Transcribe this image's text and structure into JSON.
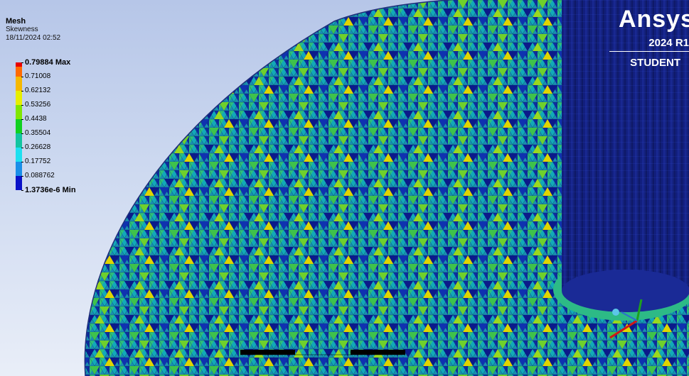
{
  "legend": {
    "title": "Mesh",
    "variable": "Skewness",
    "timestamp": "18/11/2024 02:52",
    "entries": [
      {
        "label": "0.79884 Max",
        "color": "#e80000"
      },
      {
        "label": "0.71008",
        "color": "#ff6a00"
      },
      {
        "label": "0.62132",
        "color": "#f5b800"
      },
      {
        "label": "0.53256",
        "color": "#e7ee00"
      },
      {
        "label": "0.4438",
        "color": "#80e600"
      },
      {
        "label": "0.35504",
        "color": "#10d020"
      },
      {
        "label": "0.26628",
        "color": "#12c4a0"
      },
      {
        "label": "0.17752",
        "color": "#1de0f0"
      },
      {
        "label": "0.088762",
        "color": "#1a8fe8"
      },
      {
        "label": "1.3736e-6 Min",
        "color": "#0a12c8"
      }
    ]
  },
  "brand": {
    "name": "Ansys",
    "version": "2024 R1",
    "edition": "STUDENT"
  },
  "colors": {
    "mesh_low": "#0b1a8a",
    "mesh_mid": "#16a6b0",
    "mesh_high": "#7dcf2f",
    "cylinder": "#13217a",
    "background_top": "#b6c6e8",
    "background_bottom": "#e9eef8"
  }
}
